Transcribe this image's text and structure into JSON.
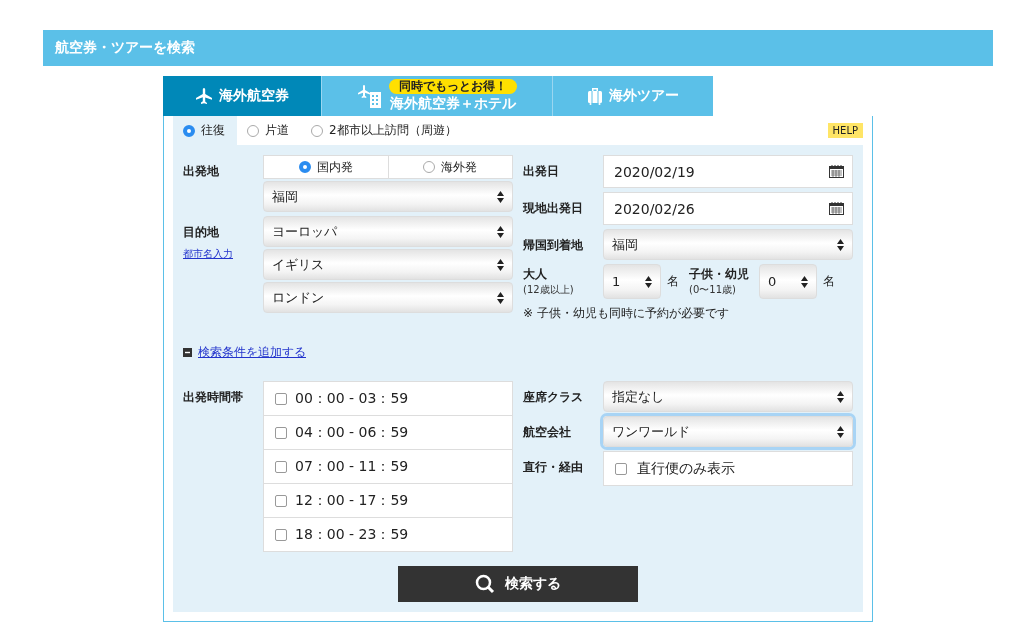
{
  "header": {
    "title": "航空券・ツアーを検索"
  },
  "tabs": [
    {
      "kind": "flight",
      "label": "海外航空券",
      "selected": true
    },
    {
      "kind": "hotel",
      "label": "海外航空券＋ホテル",
      "badge": "同時でもっとお得！",
      "selected": false
    },
    {
      "kind": "tour",
      "label": "海外ツアー",
      "selected": false
    }
  ],
  "trip_types": [
    {
      "label": "往復",
      "selected": true
    },
    {
      "label": "片道",
      "selected": false
    },
    {
      "label": "2都市以上訪問（周遊）",
      "selected": false
    }
  ],
  "help": "HELP",
  "origin": {
    "label": "出発地",
    "options": [
      {
        "label": "国内発",
        "selected": true
      },
      {
        "label": "海外発",
        "selected": false
      }
    ],
    "value": "福岡"
  },
  "destination": {
    "label": "目的地",
    "link": "都市名入力",
    "selects": [
      "ヨーロッパ",
      "イギリス",
      "ロンドン"
    ]
  },
  "departure_date": {
    "label": "出発日",
    "value": "2020/02/19"
  },
  "return_date": {
    "label": "現地出発日",
    "value": "2020/02/26"
  },
  "arrival": {
    "label": "帰国到着地",
    "value": "福岡"
  },
  "adults": {
    "label": "大人",
    "note": "(12歳以上)",
    "value": "1",
    "unit": "名"
  },
  "children": {
    "label": "子供・幼児",
    "note": "(0〜11歳)",
    "value": "0",
    "unit": "名"
  },
  "passenger_note": "※ 子供・幼児も同時に予約が必要です",
  "more_conditions": {
    "label": "検索条件を追加する",
    "expanded": true
  },
  "time_slots": {
    "label": "出発時間帯",
    "items": [
      {
        "label": "00：00 - 03：59",
        "checked": false
      },
      {
        "label": "04：00 - 06：59",
        "checked": false
      },
      {
        "label": "07：00 - 11：59",
        "checked": false
      },
      {
        "label": "12：00 - 17：59",
        "checked": false
      },
      {
        "label": "18：00 - 23：59",
        "checked": false
      }
    ]
  },
  "seat_class": {
    "label": "座席クラス",
    "value": "指定なし"
  },
  "airline": {
    "label": "航空会社",
    "value": "ワンワールド",
    "focused": true
  },
  "direct": {
    "label": "直行・経由",
    "option": "直行便のみ表示",
    "checked": false
  },
  "search_button": "検索する"
}
